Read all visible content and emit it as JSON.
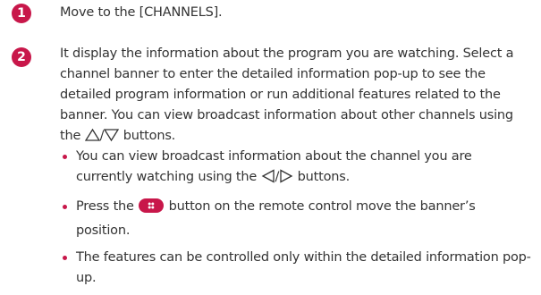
{
  "colors": {
    "accent": "#c8174a",
    "text": "#333333"
  },
  "steps": [
    {
      "number": "1",
      "text": "Move to the [CHANNELS]."
    },
    {
      "number": "2",
      "text_before": "It display the information about the program you are watching. Select a channel banner to enter the detailed information pop-up to see the detailed program information or run additional features related to the banner. You can view broadcast information about other channels using the ",
      "glyph_sep": "/",
      "text_after": " buttons.",
      "icons": [
        "up-triangle-icon",
        "down-triangle-icon"
      ]
    }
  ],
  "bullets": [
    {
      "text_before": "You can view broadcast information about the channel you are currently watching using the ",
      "glyph_sep": "/",
      "text_after": " buttons.",
      "icons": [
        "left-triangle-icon",
        "right-triangle-icon"
      ]
    },
    {
      "text_before": "Press the ",
      "text_after": " button on the remote control move the banner’s position.",
      "icons": [
        "wheel-ok-button-icon"
      ]
    },
    {
      "text": "The features can be controlled only within the detailed information pop-up."
    }
  ]
}
